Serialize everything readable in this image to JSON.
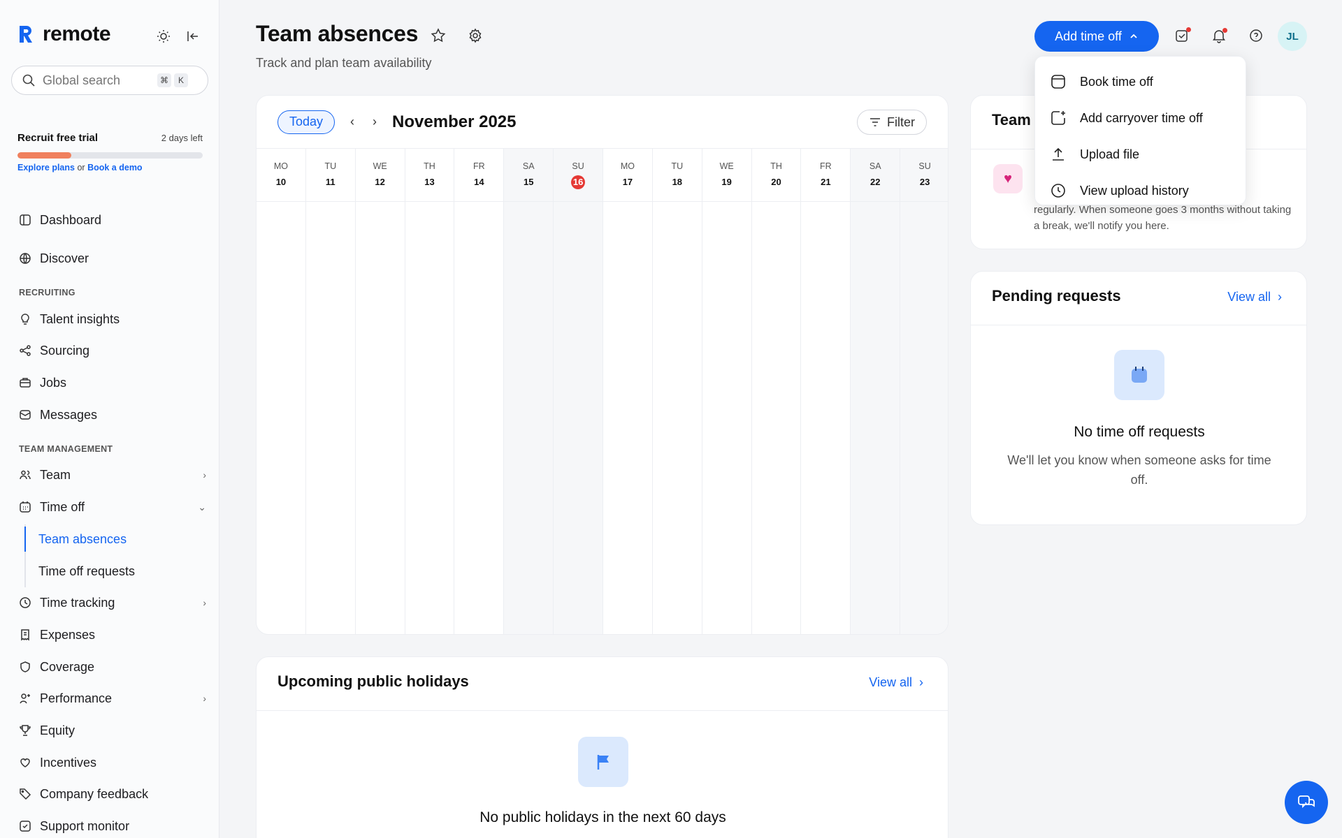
{
  "brand": {
    "name": "remote"
  },
  "search": {
    "placeholder": "Global search",
    "shortcut_mod": "⌘",
    "shortcut_key": "K"
  },
  "trial": {
    "title": "Recruit free trial",
    "days_left": "2 days left",
    "progress": 0.29,
    "explore": "Explore plans",
    "or": "or",
    "demo": "Book a demo"
  },
  "nav": {
    "dashboard": "Dashboard",
    "discover": "Discover",
    "section_recruiting": "RECRUITING",
    "talent": "Talent insights",
    "sourcing": "Sourcing",
    "jobs": "Jobs",
    "messages": "Messages",
    "section_team": "TEAM MANAGEMENT",
    "team": "Team",
    "timeoff": "Time off",
    "team_absences": "Team absences",
    "timeoff_requests": "Time off requests",
    "time_tracking": "Time tracking",
    "expenses": "Expenses",
    "coverage": "Coverage",
    "performance": "Performance",
    "equity": "Equity",
    "incentives": "Incentives",
    "company_feedback": "Company feedback",
    "support_monitor": "Support monitor"
  },
  "header": {
    "title": "Team absences",
    "subtitle": "Track and plan team availability",
    "add_label": "Add time off",
    "avatar": "JL"
  },
  "calendar": {
    "today_label": "Today",
    "month": "November 2025",
    "filter_label": "Filter",
    "days": [
      {
        "dow": "MO",
        "num": "10"
      },
      {
        "dow": "TU",
        "num": "11"
      },
      {
        "dow": "WE",
        "num": "12"
      },
      {
        "dow": "TH",
        "num": "13"
      },
      {
        "dow": "FR",
        "num": "14"
      },
      {
        "dow": "SA",
        "num": "15"
      },
      {
        "dow": "SU",
        "num": "16"
      },
      {
        "dow": "MO",
        "num": "17"
      },
      {
        "dow": "TU",
        "num": "18"
      },
      {
        "dow": "WE",
        "num": "19"
      },
      {
        "dow": "TH",
        "num": "20"
      },
      {
        "dow": "FR",
        "num": "21"
      },
      {
        "dow": "SA",
        "num": "22"
      },
      {
        "dow": "SU",
        "num": "23"
      }
    ],
    "today_num": "16"
  },
  "holidays": {
    "title": "Upcoming public holidays",
    "view_all": "View all",
    "empty_title": "No public holidays in the next 60 days"
  },
  "team_card": {
    "title": "Team",
    "desc": "regularly. When someone goes 3 months without taking a break, we'll notify you here."
  },
  "pending": {
    "title": "Pending requests",
    "view_all": "View all",
    "empty_title": "No time off requests",
    "empty_desc": "We'll let you know when someone asks for time off."
  },
  "dropdown": {
    "items": [
      "Book time off",
      "Add carryover time off",
      "Upload file",
      "View upload history"
    ]
  },
  "colors": {
    "accent": "#1565f0",
    "today": "#e53935",
    "trial_fill": "#f0805d"
  }
}
